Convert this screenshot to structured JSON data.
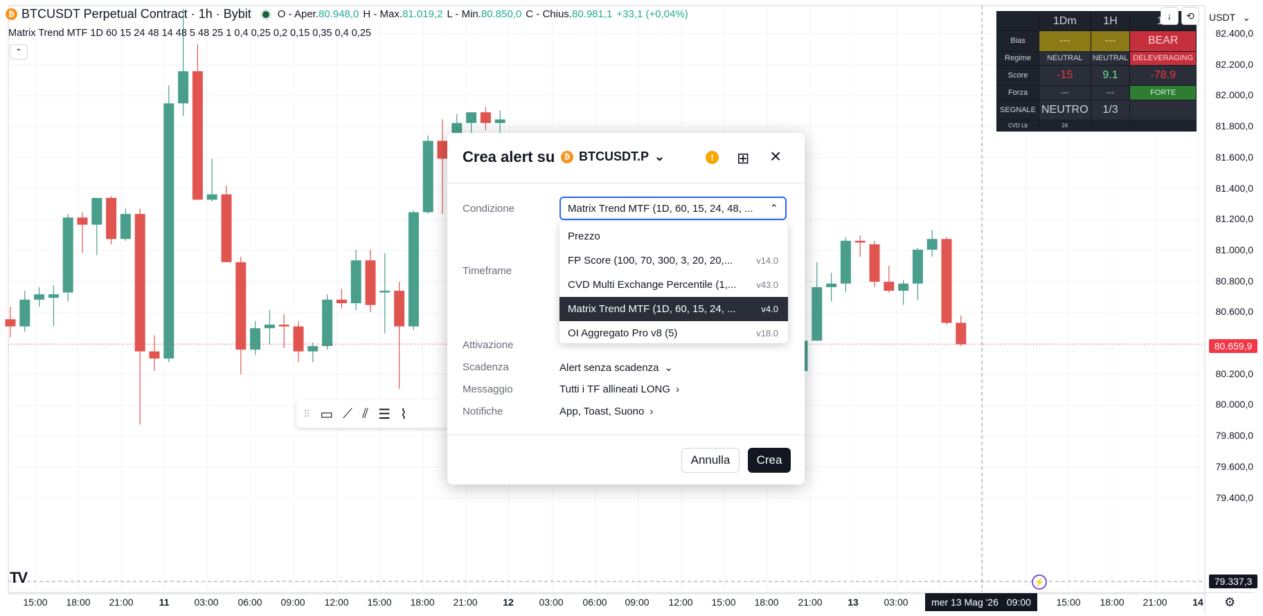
{
  "header": {
    "symbol_title": "BTCUSDT Perpetual Contract · 1h · Bybit",
    "open_label": "O - Aper.",
    "open_value": "80.948,0",
    "high_label": "H - Max.",
    "high_value": "81.019,2",
    "low_label": "L - Min.",
    "low_value": "80.850,0",
    "close_label": "C - Chius.",
    "close_value": "80.981,1",
    "change": "+33,1 (+0,04%)",
    "indicator_line": "Matrix Trend MTF 1D 60 15 24 48 14 48 5 48 25 1 0,4 0,25 0,2 0,15 0,35 0,4 0,25"
  },
  "mtf_table": {
    "columns": [
      "1Dm",
      "1H",
      "15"
    ],
    "rows": [
      {
        "label": "Bias",
        "cells": [
          "---",
          "---",
          "BEAR"
        ]
      },
      {
        "label": "Regime",
        "cells": [
          "NEUTRAL",
          "NEUTRAL",
          "DELEVERAGING"
        ]
      },
      {
        "label": "Score",
        "cells": [
          "-15",
          "9.1",
          "-78.9"
        ]
      },
      {
        "label": "Forza",
        "cells": [
          "---",
          "---",
          "FORTE"
        ]
      },
      {
        "label": "SEGNALE",
        "cells": [
          "NEUTRO",
          "1/3",
          ""
        ]
      },
      {
        "label": "CVD Lb",
        "cells": [
          "24",
          "",
          ""
        ]
      }
    ]
  },
  "currency": "USDT",
  "price_axis": [
    "82.400,0",
    "82.200,0",
    "82.000,0",
    "81.800,0",
    "81.600,0",
    "81.400,0",
    "81.200,0",
    "81.000,0",
    "80.800,0",
    "80.600,0",
    "80.400,0",
    "80.200,0",
    "80.000,0",
    "79.800,0",
    "79.600,0",
    "79.400,0"
  ],
  "current_price": "80.659,9",
  "crosshair_price": "79.337,3",
  "time_axis": [
    "15:00",
    "18:00",
    "21:00",
    "11",
    "03:00",
    "06:00",
    "09:00",
    "12:00",
    "15:00",
    "18:00",
    "21:00",
    "12",
    "03:00",
    "06:00",
    "09:00",
    "12:00",
    "15:00",
    "18:00",
    "21:00",
    "13",
    "03:00",
    "09:00",
    "15:00",
    "18:00",
    "21:00",
    "14"
  ],
  "crosshair_time": {
    "date": "mer 13 Mag '26",
    "time": "09:00"
  },
  "dialog": {
    "title": "Crea alert su",
    "symbol": "BTCUSDT.P",
    "condition_label": "Condizione",
    "condition_value": "Matrix Trend MTF (1D, 60, 15, 24, 48, ...",
    "timeframe_label": "Timeframe",
    "activation_label": "Attivazione",
    "expiry_label": "Scadenza",
    "expiry_value": "Alert senza scadenza",
    "message_label": "Messaggio",
    "message_value": "Tutti i TF allineati LONG",
    "notifications_label": "Notifiche",
    "notifications_value": "App, Toast, Suono",
    "cancel_label": "Annulla",
    "create_label": "Crea",
    "dropdown": [
      {
        "label": "Prezzo",
        "version": ""
      },
      {
        "label": "FP Score (100, 70, 300, 3, 20, 20,...",
        "version": "v14.0"
      },
      {
        "label": "CVD Multi Exchange Percentile (1,...",
        "version": "v43.0"
      },
      {
        "label": "Matrix Trend MTF (1D, 60, 15, 24, ...",
        "version": "v4.0"
      },
      {
        "label": "OI Aggregato Pro v8 (5)",
        "version": "v18.0"
      }
    ]
  },
  "chart_data": {
    "type": "candlestick",
    "ylim": [
      79300,
      82500
    ],
    "candles": [
      {
        "o": 80800,
        "h": 80870,
        "l": 80700,
        "c": 80760
      },
      {
        "o": 80760,
        "h": 80960,
        "l": 80730,
        "c": 80910
      },
      {
        "o": 80910,
        "h": 80980,
        "l": 80870,
        "c": 80940
      },
      {
        "o": 80920,
        "h": 80990,
        "l": 80760,
        "c": 80940
      },
      {
        "o": 80950,
        "h": 81390,
        "l": 80900,
        "c": 81370
      },
      {
        "o": 81370,
        "h": 81400,
        "l": 81170,
        "c": 81330
      },
      {
        "o": 81330,
        "h": 81480,
        "l": 81160,
        "c": 81480
      },
      {
        "o": 81480,
        "h": 81490,
        "l": 81220,
        "c": 81250
      },
      {
        "o": 81250,
        "h": 81420,
        "l": 81240,
        "c": 81390
      },
      {
        "o": 81390,
        "h": 81420,
        "l": 80210,
        "c": 80620
      },
      {
        "o": 80620,
        "h": 80710,
        "l": 80510,
        "c": 80580
      },
      {
        "o": 80580,
        "h": 82110,
        "l": 80560,
        "c": 82010
      },
      {
        "o": 82010,
        "h": 82540,
        "l": 81940,
        "c": 82190
      },
      {
        "o": 82190,
        "h": 82340,
        "l": 81470,
        "c": 81470
      },
      {
        "o": 81470,
        "h": 81700,
        "l": 81460,
        "c": 81500
      },
      {
        "o": 81500,
        "h": 81550,
        "l": 81120,
        "c": 81120
      },
      {
        "o": 81120,
        "h": 81150,
        "l": 80490,
        "c": 80630
      },
      {
        "o": 80630,
        "h": 80790,
        "l": 80600,
        "c": 80750
      },
      {
        "o": 80750,
        "h": 80850,
        "l": 80660,
        "c": 80770
      },
      {
        "o": 80770,
        "h": 80830,
        "l": 80640,
        "c": 80760
      },
      {
        "o": 80760,
        "h": 80790,
        "l": 80560,
        "c": 80620
      },
      {
        "o": 80620,
        "h": 80670,
        "l": 80560,
        "c": 80650
      },
      {
        "o": 80650,
        "h": 80940,
        "l": 80630,
        "c": 80910
      },
      {
        "o": 80910,
        "h": 80970,
        "l": 80860,
        "c": 80890
      },
      {
        "o": 80890,
        "h": 81190,
        "l": 80850,
        "c": 81130
      },
      {
        "o": 81130,
        "h": 81190,
        "l": 80840,
        "c": 80880
      },
      {
        "o": 80950,
        "h": 81170,
        "l": 80720,
        "c": 80960
      },
      {
        "o": 80960,
        "h": 81010,
        "l": 80410,
        "c": 80760
      },
      {
        "o": 80760,
        "h": 81410,
        "l": 80740,
        "c": 81400
      },
      {
        "o": 81400,
        "h": 81830,
        "l": 81390,
        "c": 81800
      },
      {
        "o": 81800,
        "h": 81920,
        "l": 81390,
        "c": 81700
      },
      {
        "o": 81700,
        "h": 81950,
        "l": 81690,
        "c": 81900
      },
      {
        "o": 81900,
        "h": 81940,
        "l": 81800,
        "c": 81960
      },
      {
        "o": 81960,
        "h": 81990,
        "l": 81860,
        "c": 81900
      },
      {
        "o": 81900,
        "h": 81970,
        "l": 81840,
        "c": 81920
      },
      {
        "o": 80780,
        "h": 80830,
        "l": 80560,
        "c": 80740
      },
      {
        "o": 80740,
        "h": 80780,
        "l": 80660,
        "c": 80670
      },
      {
        "o": 80670,
        "h": 80690,
        "l": 80500,
        "c": 80580
      },
      {
        "o": 80580,
        "h": 80620,
        "l": 80480,
        "c": 80630
      },
      {
        "o": 80630,
        "h": 80660,
        "l": 80370,
        "c": 80510
      },
      {
        "o": 80510,
        "h": 80710,
        "l": 80360,
        "c": 80680
      },
      {
        "o": 80680,
        "h": 81120,
        "l": 80680,
        "c": 80980
      },
      {
        "o": 80980,
        "h": 81060,
        "l": 80900,
        "c": 81000
      },
      {
        "o": 81000,
        "h": 81260,
        "l": 80950,
        "c": 81240
      },
      {
        "o": 81240,
        "h": 81270,
        "l": 81150,
        "c": 81230
      },
      {
        "o": 81220,
        "h": 81240,
        "l": 80980,
        "c": 81010
      },
      {
        "o": 81010,
        "h": 81100,
        "l": 80950,
        "c": 80960
      },
      {
        "o": 80960,
        "h": 81020,
        "l": 80880,
        "c": 81000
      },
      {
        "o": 81000,
        "h": 81200,
        "l": 80910,
        "c": 81190
      },
      {
        "o": 81190,
        "h": 81300,
        "l": 81150,
        "c": 81250
      },
      {
        "o": 81250,
        "h": 81260,
        "l": 80770,
        "c": 80780
      },
      {
        "o": 80780,
        "h": 80820,
        "l": 80650,
        "c": 80660
      }
    ]
  }
}
